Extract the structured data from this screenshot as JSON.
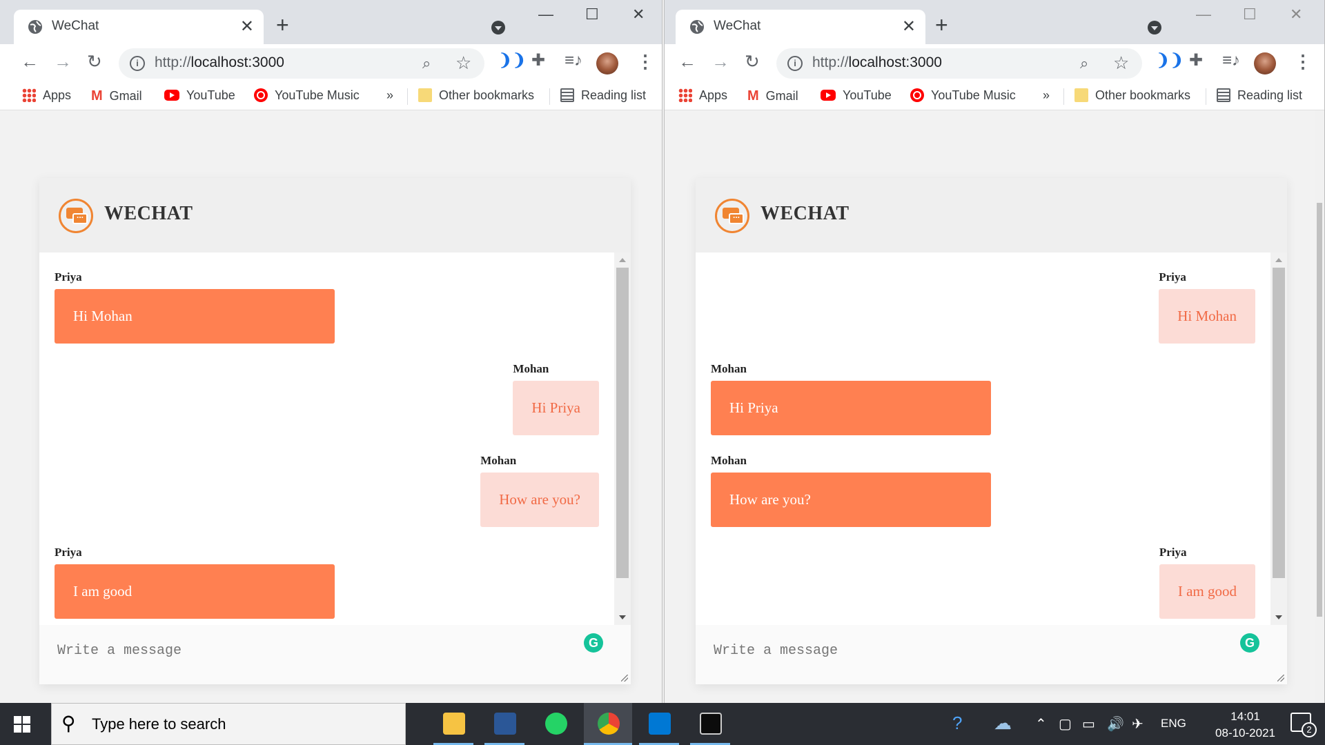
{
  "browser": {
    "tab_title": "WeChat",
    "url_proto": "http://",
    "url_host": "localhost:3000",
    "bookmarks": {
      "apps": "Apps",
      "gmail": "Gmail",
      "youtube": "YouTube",
      "youtube_music": "YouTube Music",
      "more": "»",
      "other": "Other bookmarks",
      "reading": "Reading list"
    }
  },
  "app": {
    "brand": "WECHAT",
    "input_placeholder": "Write a message"
  },
  "left_chat": {
    "messages": [
      {
        "sender": "Priya",
        "text": "Hi Mohan",
        "side": "left"
      },
      {
        "sender": "Mohan",
        "text": "Hi Priya",
        "side": "right"
      },
      {
        "sender": "Mohan",
        "text": "How are you?",
        "side": "right"
      },
      {
        "sender": "Priya",
        "text": "I am good",
        "side": "left"
      }
    ]
  },
  "right_chat": {
    "messages": [
      {
        "sender": "Priya",
        "text": "Hi Mohan",
        "side": "right"
      },
      {
        "sender": "Mohan",
        "text": "Hi Priya",
        "side": "left"
      },
      {
        "sender": "Mohan",
        "text": "How are you?",
        "side": "left"
      },
      {
        "sender": "Priya",
        "text": "I am good",
        "side": "right"
      }
    ]
  },
  "taskbar": {
    "search_placeholder": "Type here to search",
    "language": "ENG",
    "time": "14:01",
    "date": "08-10-2021",
    "notification_count": "2"
  },
  "colors": {
    "own_bubble": "#ff8051",
    "other_bubble": "#fcdcd6",
    "other_text": "#f16a45",
    "logo": "#f08532"
  },
  "icons": [
    "globe-icon",
    "close-icon",
    "new-tab-icon",
    "tab-search-icon",
    "minimize-icon",
    "maximize-icon",
    "back-icon",
    "forward-icon",
    "reload-icon",
    "info-icon",
    "zoom-icon",
    "star-icon",
    "extensions-icon",
    "media-icon",
    "profile-avatar",
    "menu-icon",
    "chat-logo-icon",
    "grammarly-icon",
    "windows-start-icon",
    "search-icon"
  ]
}
